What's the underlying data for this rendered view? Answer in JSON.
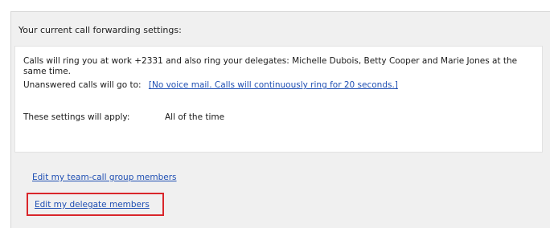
{
  "panel": {
    "title": "Your current call forwarding settings:"
  },
  "settings": {
    "ring_text": "Calls will ring you at work +2331 and also ring your delegates: Michelle Dubois, Betty Cooper and Marie Jones at the same time.",
    "unanswered_label": "Unanswered calls will go to:",
    "unanswered_link": "[No voice mail. Calls will continuously ring for 20 seconds.]",
    "apply_label": "These settings will apply:",
    "apply_value": "All of the time"
  },
  "links": {
    "team_call": "Edit my team-call group members",
    "delegate": "Edit my delegate members"
  },
  "colors": {
    "link": "#1f4fb3",
    "highlight": "#d9262b",
    "panel_bg": "#f0f0f0"
  }
}
